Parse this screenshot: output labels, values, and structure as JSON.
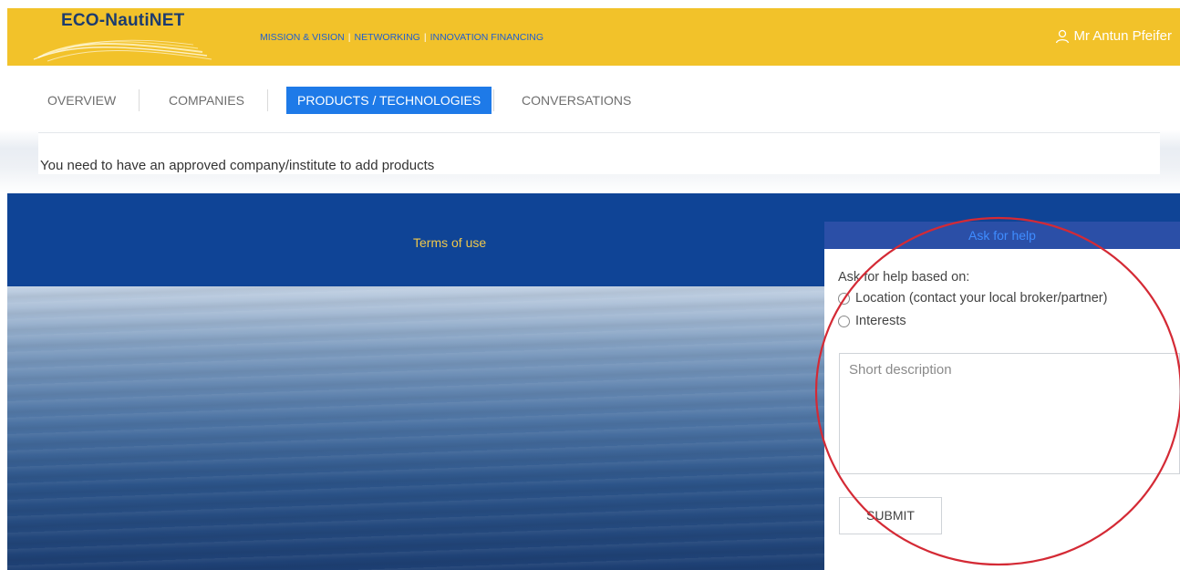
{
  "header": {
    "logo_text": "ECO-NautiNET",
    "nav": [
      "MISSION & VISION",
      "NETWORKING",
      "INNOVATION FINANCING"
    ],
    "user_name": "Mr Antun Pfeifer"
  },
  "tabs": [
    {
      "label": "OVERVIEW",
      "active": false
    },
    {
      "label": "COMPANIES",
      "active": false
    },
    {
      "label": "PRODUCTS / TECHNOLOGIES",
      "active": true
    },
    {
      "label": "CONVERSATIONS",
      "active": false
    }
  ],
  "main": {
    "message": "You need to have an approved company/institute to add products"
  },
  "footer": {
    "terms_label": "Terms of use"
  },
  "help": {
    "header": "Ask for help",
    "title": "Ask for help based on:",
    "options": [
      "Location (contact your local broker/partner)",
      "Interests"
    ],
    "description_placeholder": "Short description",
    "submit_label": "SUBMIT"
  },
  "colors": {
    "topbar": "#f2c22a",
    "active_tab": "#1e7ae8",
    "footer": "#0f4496",
    "annotation_circle": "#d42a35"
  },
  "icons": {
    "user": "user-icon"
  }
}
